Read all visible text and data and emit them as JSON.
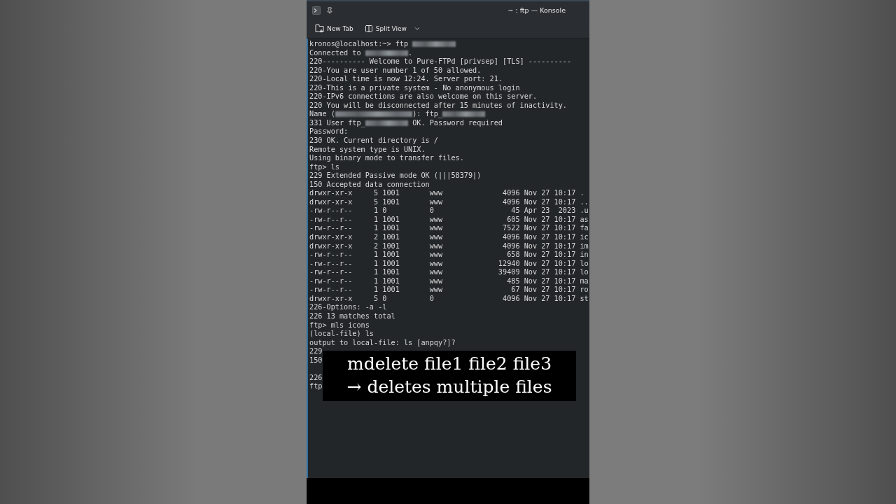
{
  "window": {
    "title": "~ : ftp — Konsole"
  },
  "toolbar": {
    "buttons": [
      {
        "kind": "new-tab",
        "label": "New Tab"
      },
      {
        "kind": "split-view",
        "label": "Split View"
      }
    ]
  },
  "terminal": {
    "lines": [
      {
        "kind": "text",
        "parts": [
          {
            "kind": "text",
            "text": "kronos@localhost:~> ftp "
          },
          {
            "kind": "blur"
          }
        ]
      },
      {
        "kind": "text",
        "parts": [
          {
            "kind": "text",
            "text": "Connected to "
          },
          {
            "kind": "blur"
          },
          {
            "kind": "text",
            "text": "."
          }
        ]
      },
      {
        "kind": "text",
        "parts": [
          {
            "kind": "text",
            "text": "220---------- Welcome to Pure-FTPd [privsep] [TLS] ----------"
          }
        ]
      },
      {
        "kind": "text",
        "parts": [
          {
            "kind": "text",
            "text": "220-You are user number 1 of 50 allowed."
          }
        ]
      },
      {
        "kind": "text",
        "parts": [
          {
            "kind": "text",
            "text": "220-Local time is now 12:24. Server port: 21."
          }
        ]
      },
      {
        "kind": "text",
        "parts": [
          {
            "kind": "text",
            "text": "220-This is a private system - No anonymous login"
          }
        ]
      },
      {
        "kind": "text",
        "parts": [
          {
            "kind": "text",
            "text": "220-IPv6 connections are also welcome on this server."
          }
        ]
      },
      {
        "kind": "text",
        "parts": [
          {
            "kind": "text",
            "text": "220 You will be disconnected after 15 minutes of inactivity."
          }
        ]
      },
      {
        "kind": "text",
        "parts": [
          {
            "kind": "text",
            "text": "Name ("
          },
          {
            "kind": "blur-long"
          },
          {
            "kind": "text",
            "text": "): ftp_"
          },
          {
            "kind": "blur"
          }
        ]
      },
      {
        "kind": "text",
        "parts": [
          {
            "kind": "text",
            "text": "331 User ftp_"
          },
          {
            "kind": "blur"
          },
          {
            "kind": "text",
            "text": " OK. Password required"
          }
        ]
      },
      {
        "kind": "text",
        "parts": [
          {
            "kind": "text",
            "text": "Password:"
          }
        ]
      },
      {
        "kind": "text",
        "parts": [
          {
            "kind": "text",
            "text": "230 OK. Current directory is /"
          }
        ]
      },
      {
        "kind": "text",
        "parts": [
          {
            "kind": "text",
            "text": "Remote system type is UNIX."
          }
        ]
      },
      {
        "kind": "text",
        "parts": [
          {
            "kind": "text",
            "text": "Using binary mode to transfer files."
          }
        ]
      },
      {
        "kind": "text",
        "parts": [
          {
            "kind": "text",
            "text": "ftp> ls"
          }
        ]
      },
      {
        "kind": "text",
        "parts": [
          {
            "kind": "text",
            "text": "229 Extended Passive mode OK (|||58379|)"
          }
        ]
      },
      {
        "kind": "text",
        "parts": [
          {
            "kind": "text",
            "text": "150 Accepted data connection"
          }
        ]
      },
      {
        "kind": "text",
        "parts": [
          {
            "kind": "text",
            "text": "drwxr-xr-x     5 1001       www              4096 Nov 27 10:17 ."
          }
        ]
      },
      {
        "kind": "text",
        "parts": [
          {
            "kind": "text",
            "text": "drwxr-xr-x     5 1001       www              4096 Nov 27 10:17 .."
          }
        ]
      },
      {
        "kind": "text",
        "parts": [
          {
            "kind": "text",
            "text": "-rw-r--r--     1 0          0                  45 Apr 23  2023 .u"
          }
        ]
      },
      {
        "kind": "text",
        "parts": [
          {
            "kind": "text",
            "text": "-rw-r--r--     1 1001       www               605 Nov 27 10:17 as"
          }
        ]
      },
      {
        "kind": "text",
        "parts": [
          {
            "kind": "text",
            "text": "-rw-r--r--     1 1001       www              7522 Nov 27 10:17 fa"
          }
        ]
      },
      {
        "kind": "text",
        "parts": [
          {
            "kind": "text",
            "text": "drwxr-xr-x     2 1001       www              4096 Nov 27 10:17 ic"
          }
        ]
      },
      {
        "kind": "text",
        "parts": [
          {
            "kind": "text",
            "text": "drwxr-xr-x     2 1001       www              4096 Nov 27 10:17 im"
          }
        ]
      },
      {
        "kind": "text",
        "parts": [
          {
            "kind": "text",
            "text": "-rw-r--r--     1 1001       www               658 Nov 27 10:17 in"
          }
        ]
      },
      {
        "kind": "text",
        "parts": [
          {
            "kind": "text",
            "text": "-rw-r--r--     1 1001       www             12940 Nov 27 10:17 lo"
          }
        ]
      },
      {
        "kind": "text",
        "parts": [
          {
            "kind": "text",
            "text": "-rw-r--r--     1 1001       www             39409 Nov 27 10:17 lo"
          }
        ]
      },
      {
        "kind": "text",
        "parts": [
          {
            "kind": "text",
            "text": "-rw-r--r--     1 1001       www               485 Nov 27 10:17 ma"
          }
        ]
      },
      {
        "kind": "text",
        "parts": [
          {
            "kind": "text",
            "text": "-rw-r--r--     1 1001       www                67 Nov 27 10:17 ro"
          }
        ]
      },
      {
        "kind": "text",
        "parts": [
          {
            "kind": "text",
            "text": "drwxr-xr-x     5 0          0                4096 Nov 27 10:17 st"
          }
        ]
      },
      {
        "kind": "text",
        "parts": [
          {
            "kind": "text",
            "text": "226-Options: -a -l"
          }
        ]
      },
      {
        "kind": "text",
        "parts": [
          {
            "kind": "text",
            "text": "226 13 matches total"
          }
        ]
      },
      {
        "kind": "text",
        "parts": [
          {
            "kind": "text",
            "text": "ftp> mls icons"
          }
        ]
      },
      {
        "kind": "text",
        "parts": [
          {
            "kind": "text",
            "text": "(local-file) ls"
          }
        ]
      },
      {
        "kind": "text",
        "parts": [
          {
            "kind": "text",
            "text": "output to local-file: ls [anpqy?]?"
          }
        ]
      },
      {
        "kind": "text",
        "parts": [
          {
            "kind": "text",
            "text": "229"
          }
        ]
      },
      {
        "kind": "text",
        "parts": [
          {
            "kind": "text",
            "text": "150"
          }
        ]
      },
      {
        "kind": "blank"
      },
      {
        "kind": "text",
        "parts": [
          {
            "kind": "text",
            "text": "226"
          }
        ]
      },
      {
        "kind": "text",
        "parts": [
          {
            "kind": "text",
            "text": "ftp"
          }
        ]
      }
    ]
  },
  "caption": {
    "lines": [
      "mdelete file1 file2 file3",
      "→ deletes multiple files"
    ]
  }
}
